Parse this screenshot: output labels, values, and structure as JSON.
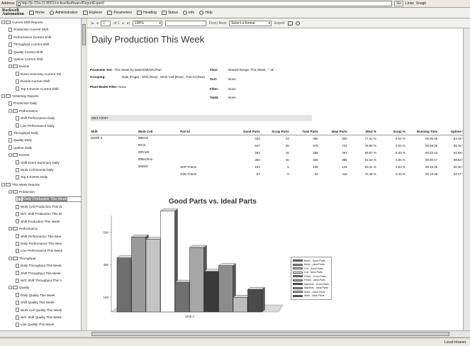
{
  "addressbar": {
    "label": "Address",
    "url": "http://jx-03sv11:8001/rockwellsoftware/ReportExpert/",
    "go": "Go",
    "links": "Links",
    "snagit": "Snagit"
  },
  "appbar": {
    "logo_line1": "Rockwell",
    "logo_line2": "Automation",
    "buttons": [
      "Home",
      "Administration",
      "Explorer",
      "Parameters",
      "Heading",
      "Status",
      "Info",
      "Help"
    ]
  },
  "report_toolbar": {
    "page_value": "1",
    "page_of": "of 1",
    "zoom": "100%",
    "find_next": "Find | Next",
    "format_placeholder": "Select a format",
    "export": "Export"
  },
  "sidebar": {
    "items": [
      {
        "label": "Current Shift Reports",
        "level": 0,
        "type": "folder",
        "exp": "−"
      },
      {
        "label": "Production Current Shift",
        "level": 1,
        "type": "page"
      },
      {
        "label": "Performance Current Shift",
        "level": 1,
        "type": "page"
      },
      {
        "label": "Throughput Current Shift",
        "level": 1,
        "type": "page"
      },
      {
        "label": "Quality Current Shift",
        "level": 1,
        "type": "page"
      },
      {
        "label": "Uptime Current Shift",
        "level": 1,
        "type": "page"
      },
      {
        "label": "Events",
        "level": 1,
        "type": "folder",
        "exp": "−"
      },
      {
        "label": "Event Summary Current Shi",
        "level": 2,
        "type": "page"
      },
      {
        "label": "Events Current Shift",
        "level": 2,
        "type": "page"
      },
      {
        "label": "Top 5 Events Current Shift",
        "level": 2,
        "type": "page"
      },
      {
        "label": "Yesterday Reports",
        "level": 0,
        "type": "folder",
        "exp": "−"
      },
      {
        "label": "Production Daily",
        "level": 1,
        "type": "page"
      },
      {
        "label": "Performance",
        "level": 1,
        "type": "folder",
        "exp": "−"
      },
      {
        "label": "Shift Performance Daily",
        "level": 2,
        "type": "page"
      },
      {
        "label": "Line Performance Daily",
        "level": 2,
        "type": "page"
      },
      {
        "label": "Throughput Daily",
        "level": 1,
        "type": "page"
      },
      {
        "label": "Quality Daily",
        "level": 1,
        "type": "page"
      },
      {
        "label": "Uptime Daily",
        "level": 1,
        "type": "page"
      },
      {
        "label": "Events",
        "level": 1,
        "type": "folder",
        "exp": "−"
      },
      {
        "label": "Shift Event Summary Daily",
        "level": 2,
        "type": "page"
      },
      {
        "label": "Work Cell Events Daily",
        "level": 2,
        "type": "page"
      },
      {
        "label": "Top 5 Events Daily",
        "level": 2,
        "type": "page"
      },
      {
        "label": "This Week Reports",
        "level": 0,
        "type": "folder",
        "exp": "−"
      },
      {
        "label": "Production",
        "level": 1,
        "type": "folder",
        "exp": "−"
      },
      {
        "label": "Daily Production This Week",
        "level": 2,
        "type": "page",
        "selected": true
      },
      {
        "label": "Work Cell Production This W",
        "level": 2,
        "type": "page"
      },
      {
        "label": "W/C Shift Production This W",
        "level": 2,
        "type": "page"
      },
      {
        "label": "Shift Production This Week",
        "level": 2,
        "type": "page"
      },
      {
        "label": "Performance",
        "level": 1,
        "type": "folder",
        "exp": "−"
      },
      {
        "label": "Shift Performance This Wee",
        "level": 2,
        "type": "page"
      },
      {
        "label": "Daily Performance This Wee",
        "level": 2,
        "type": "page"
      },
      {
        "label": "Line Performance This Week",
        "level": 2,
        "type": "page"
      },
      {
        "label": "Throughput",
        "level": 1,
        "type": "folder",
        "exp": "−"
      },
      {
        "label": "Daily Throughput This Week",
        "level": 2,
        "type": "page"
      },
      {
        "label": "Shift Throughput This Week",
        "level": 2,
        "type": "page"
      },
      {
        "label": "W/C Shift Throughput This V",
        "level": 2,
        "type": "page"
      },
      {
        "label": "Quality",
        "level": 1,
        "type": "folder",
        "exp": "−"
      },
      {
        "label": "Daily Quality This Week",
        "level": 2,
        "type": "page"
      },
      {
        "label": "Shift Quality This Week",
        "level": 2,
        "type": "page"
      },
      {
        "label": "Work Cell Quality This Week",
        "level": 2,
        "type": "page"
      },
      {
        "label": "W/C Shift Quality This Week",
        "level": 2,
        "type": "page"
      },
      {
        "label": "Line Quality This Week",
        "level": 2,
        "type": "page"
      }
    ]
  },
  "report": {
    "title": "Daily Production This Week",
    "params_left": [
      {
        "label": "Parameter Set:",
        "value": "This Week by Date/Shift/WC/Part"
      },
      {
        "label": "Grouping:",
        "value": "Date (Page) , Shift (Row) , Work Cell (Row) , Part Id (Row)"
      },
      {
        "label": "Plant Model Filter:",
        "value": "None"
      }
    ],
    "params_right": [
      {
        "label": "Time:",
        "value": "Named Range: This Week, -- All --"
      },
      {
        "label": "Sort:",
        "value": "None"
      },
      {
        "label": "Filter:",
        "value": "None"
      },
      {
        "label": "TopN:",
        "value": "None"
      }
    ],
    "date": "5/17/2007",
    "table": {
      "headers": [
        "Shift",
        "Work Cell",
        "Part Id",
        "Good Parts",
        "Scrap Parts",
        "Total Parts",
        "Ideal Parts",
        "Ideal %",
        "Scrap %",
        "Running Time",
        "Uptime %"
      ],
      "rows": [
        [
          "Shift 2",
          "Bend",
          "",
          "433",
          "23",
          "456",
          "562",
          "77.01 %",
          "5.04 %",
          "00:26:46",
          "84.34 %"
        ],
        [
          "",
          "Cut",
          "",
          "547",
          "29",
          "576",
          "721",
          "75.90 %",
          "5.03 %",
          "00:28:29",
          "85.15 %"
        ],
        [
          "",
          "Finish",
          "",
          "283",
          "15",
          "298",
          "497",
          "56.97 %",
          "5.03 %",
          "00:23:16",
          "62.69 %"
        ],
        [
          "",
          "Machine",
          "",
          "350",
          "16",
          "336",
          "385",
          "81.33 %",
          "4.91 %",
          "00:30:17",
          "89.83 %"
        ],
        [
          "",
          "Weld",
          "SHP Frame",
          "103",
          "5",
          "108",
          "124",
          "83.31 %",
          "4.63 %",
          "00:15:29",
          "90.30 %"
        ],
        [
          "",
          "",
          "SSD Frame",
          "87",
          "5",
          "92",
          "115",
          "75.48 %",
          "5.43 %",
          "00:13:28",
          "83.27 %"
        ]
      ]
    }
  },
  "chart_data": {
    "type": "bar",
    "title": "Good Parts vs. Ideal Parts",
    "categories": [
      "Shift 2"
    ],
    "ylabel": "",
    "y_ticks": [
      "190",
      "390",
      "590"
    ],
    "ylim": [
      100,
      720
    ],
    "series": [
      {
        "name": "Bend - Good Parts",
        "values": [
          433
        ],
        "color": "#6e6e6e"
      },
      {
        "name": "Bend - Ideal Parts",
        "values": [
          562
        ],
        "color": "#9a9a9a"
      },
      {
        "name": "Cut - Good Parts",
        "values": [
          547
        ],
        "color": "#c4c4c4"
      },
      {
        "name": "Cut - Ideal Parts",
        "values": [
          721
        ],
        "color": "#ffffff"
      },
      {
        "name": "Finish - Good Parts",
        "values": [
          283
        ],
        "color": "#707070"
      },
      {
        "name": "Finish - Ideal Parts",
        "values": [
          497
        ],
        "color": "#a6a6a6"
      },
      {
        "name": "Machine - Good Parts",
        "values": [
          350
        ],
        "color": "#3a3a3a"
      },
      {
        "name": "Machine - Ideal Parts",
        "values": [
          385
        ],
        "color": "#8c8c8c"
      },
      {
        "name": "Weld - Good Parts",
        "values": [
          190
        ],
        "color": "#bdbdbd"
      },
      {
        "name": "Weld - Ideal Parts",
        "values": [
          239
        ],
        "color": "#4a4a4a"
      }
    ],
    "legend_position": "right"
  },
  "statusbar": {
    "zone": "Local intranet"
  }
}
